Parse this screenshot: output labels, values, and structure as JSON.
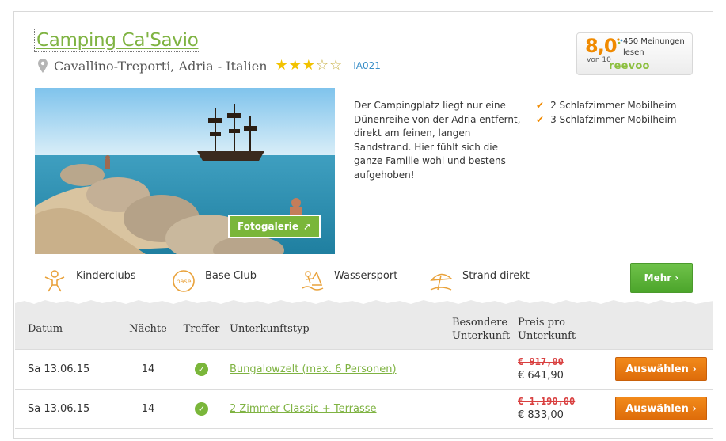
{
  "camp": {
    "title": "Camping Ca'Savio",
    "location": "Cavallino-Treporti, Adria - Italien",
    "stars_filled": 3,
    "stars_total": 5,
    "code": "IA021"
  },
  "rating": {
    "score": "8,0",
    "scale": "von 10",
    "reviews": "450 Meinungen lesen",
    "brand": "reevoo"
  },
  "gallery": {
    "button": "Fotogalerie"
  },
  "description": "Der Campingplatz liegt nur eine Dünenreihe von der Adria entfernt, direkt am feinen, langen Sandstrand. Hier fühlt sich die ganze Familie wohl und bestens aufgehoben!",
  "features": [
    "2 Schlafzimmer Mobilheim",
    "3 Schlafzimmer Mobilheim"
  ],
  "amenities": [
    {
      "label": "Kinderclubs",
      "icon": "kids-club-icon"
    },
    {
      "label": "Base Club",
      "icon": "base-club-icon",
      "badge": "base"
    },
    {
      "label": "Wassersport",
      "icon": "water-sport-icon"
    },
    {
      "label": "Strand direkt",
      "icon": "beach-umbrella-icon"
    }
  ],
  "more_button": "Mehr ›",
  "table": {
    "headers": {
      "date": "Datum",
      "nights": "Nächte",
      "hits": "Treffer",
      "type": "Unterkunftstyp",
      "special_1": "Besondere",
      "special_2": "Unterkunft",
      "price_1": "Preis pro",
      "price_2": "Unterkunft"
    },
    "rows": [
      {
        "date": "Sa 13.06.15",
        "nights": "14",
        "type": "Bungalowzelt (max. 6 Personen)",
        "old_price": "€  917,00",
        "new_price": "€ 641,90",
        "button": "Auswählen ›"
      },
      {
        "date": "Sa 13.06.15",
        "nights": "14",
        "type": "2 Zimmer Classic + Terrasse",
        "old_price": "€  1.190,00",
        "new_price": "€ 833,00",
        "button": "Auswählen ›"
      }
    ]
  },
  "colors": {
    "green": "#7fb342",
    "orange": "#f08a00",
    "blue": "#3a8fc8"
  }
}
